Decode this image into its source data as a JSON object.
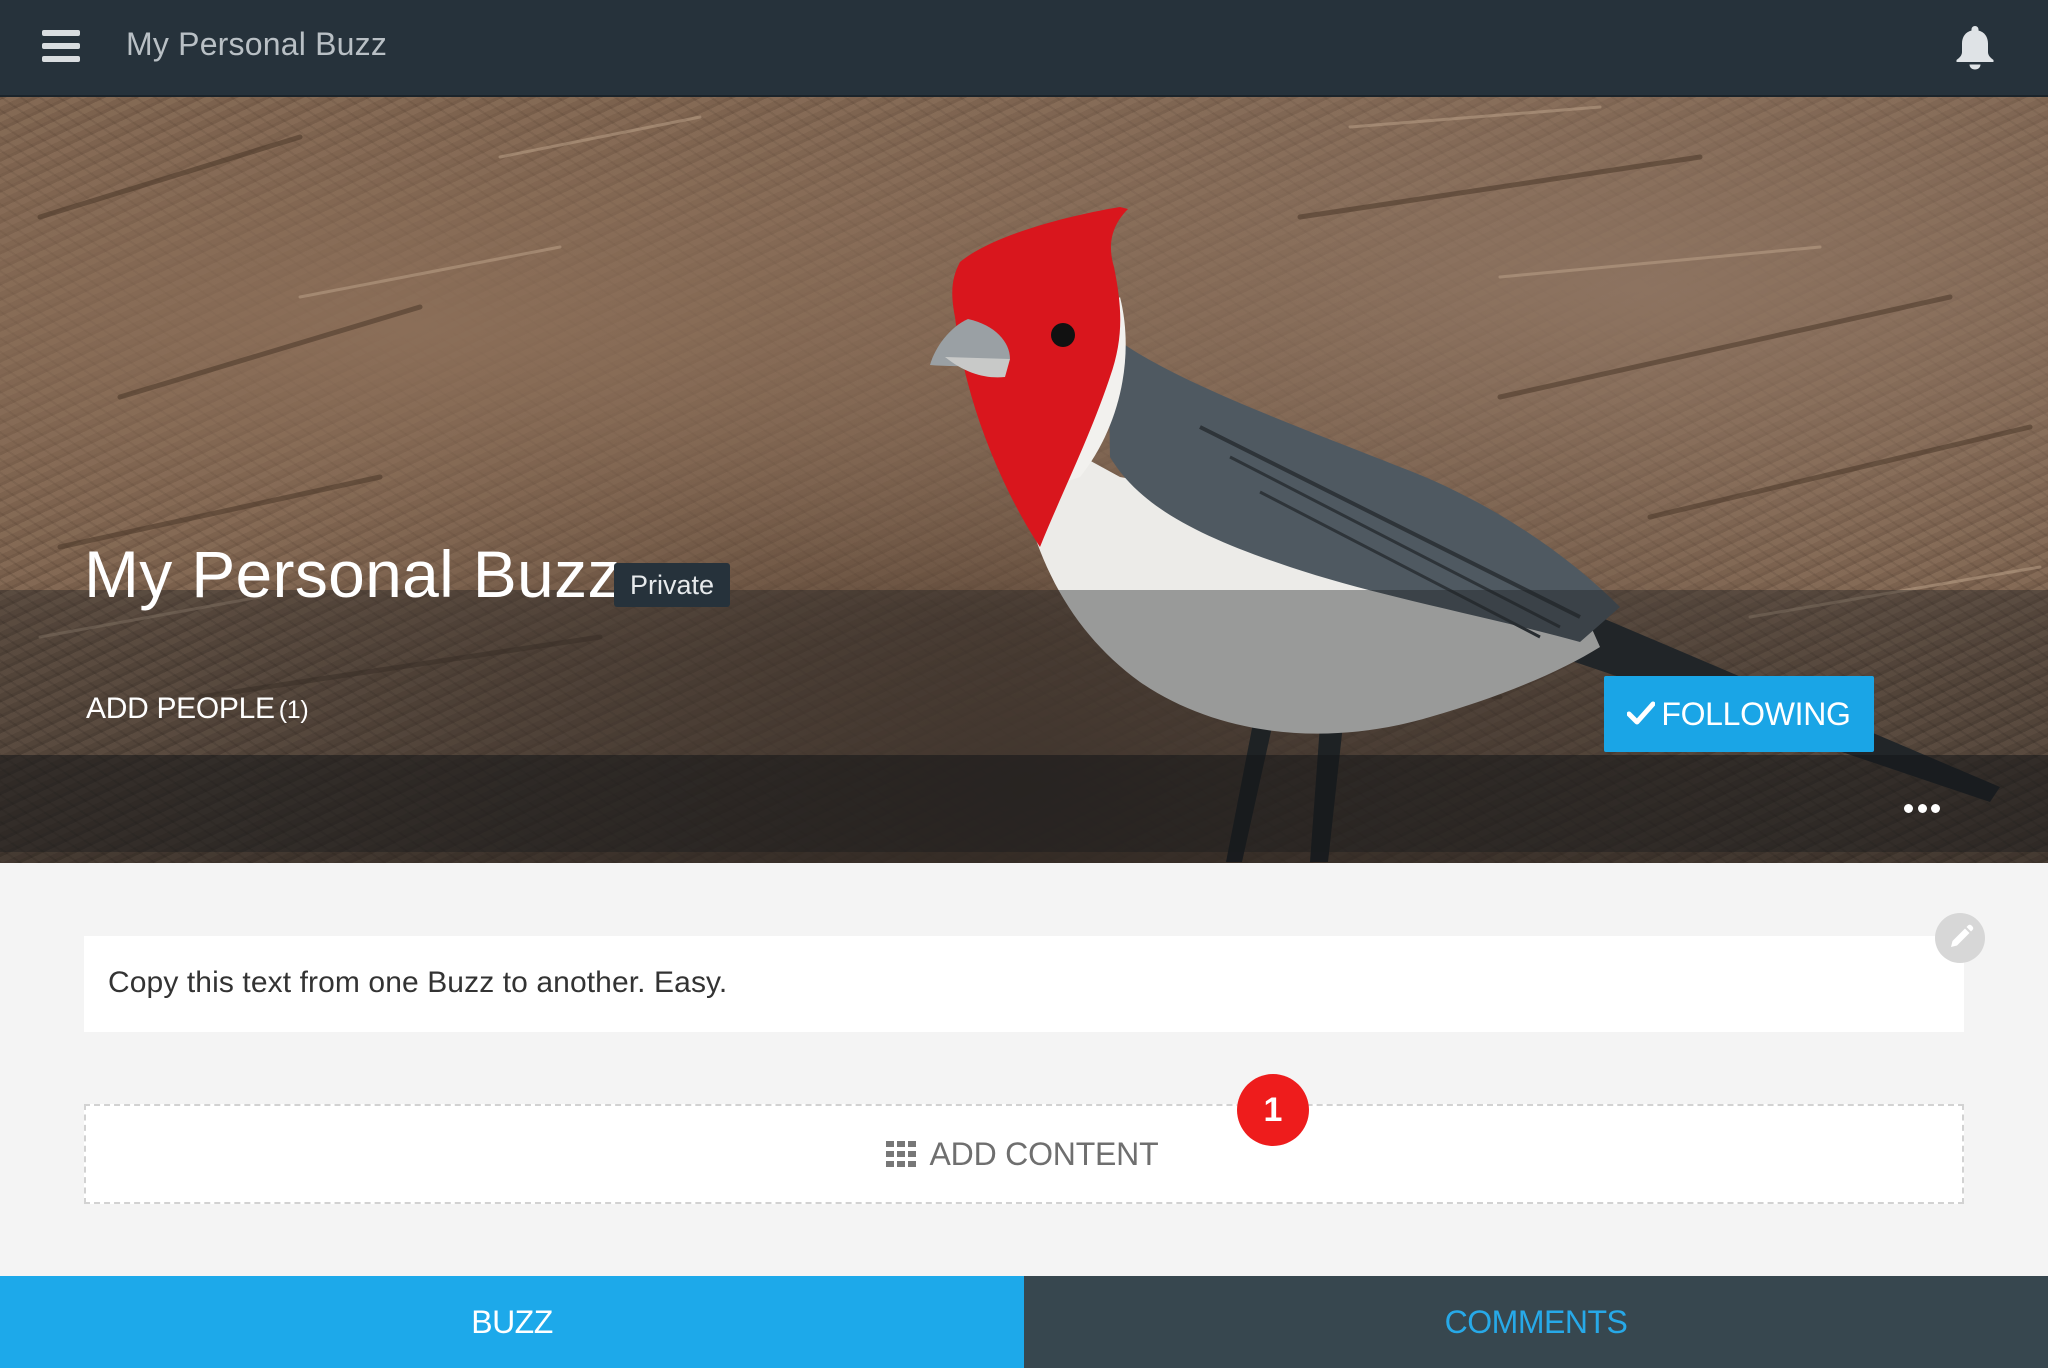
{
  "topbar": {
    "menu_icon": "hamburger-menu-icon",
    "title": "My Personal Buzz",
    "notification_icon": "bell-icon"
  },
  "hero": {
    "image_subject": "red-crested cardinal on pine needles",
    "title": "My Personal Buzz",
    "privacy": "Private",
    "add_people_label": "ADD PEOPLE",
    "add_people_count": "(1)",
    "follow_label": "FOLLOWING",
    "follow_icon": "check-icon",
    "more_icon": "ellipsis-icon"
  },
  "description": {
    "text": "Copy this text from one Buzz to another. Easy.",
    "edit_icon": "pencil-icon"
  },
  "add_content": {
    "label": "ADD CONTENT",
    "icon": "grid-icon",
    "badge_count": "1"
  },
  "tabs": [
    {
      "label": "BUZZ",
      "active": true
    },
    {
      "label": "COMMENTS",
      "active": false
    }
  ],
  "colors": {
    "topbar": "#26323b",
    "accent": "#1aa5e6",
    "badge": "#ee1c1c",
    "tab_inactive": "#37474f"
  }
}
